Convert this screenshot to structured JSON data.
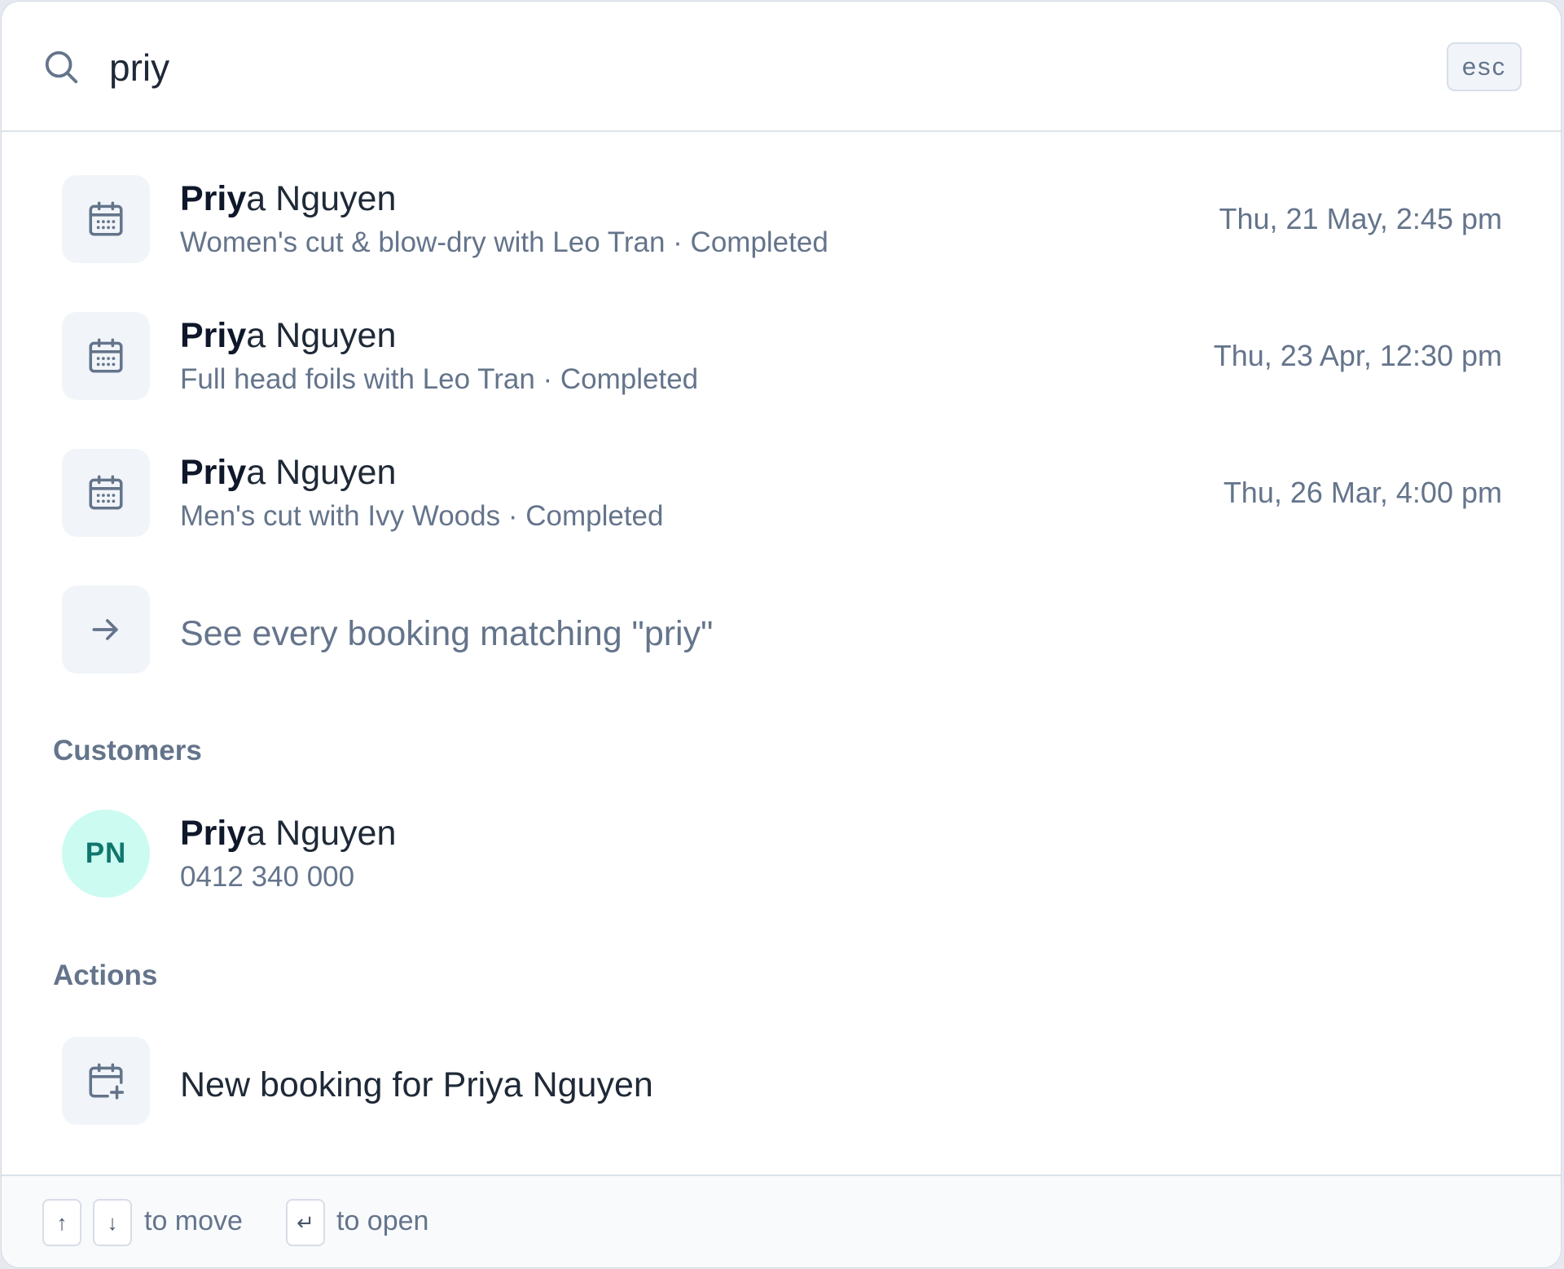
{
  "search": {
    "query": "priy",
    "esc_label": "esc"
  },
  "bookings": [
    {
      "name_match": "Priy",
      "name_rest": "a Nguyen",
      "detail": "Women's cut & blow-dry with Leo Tran · Completed",
      "datetime": "Thu, 21 May, 2:45 pm",
      "icon": "calendar-icon"
    },
    {
      "name_match": "Priy",
      "name_rest": "a Nguyen",
      "detail": "Full head foils with Leo Tran · Completed",
      "datetime": "Thu, 23 Apr, 12:30 pm",
      "icon": "calendar-icon"
    },
    {
      "name_match": "Priy",
      "name_rest": "a Nguyen",
      "detail": "Men's cut with Ivy Woods · Completed",
      "datetime": "Thu, 26 Mar, 4:00 pm",
      "icon": "calendar-icon"
    }
  ],
  "see_all": {
    "label": "See every booking matching \"priy\"",
    "icon": "arrow-right-icon"
  },
  "customers": {
    "heading": "Customers",
    "items": [
      {
        "initials": "PN",
        "name_match": "Priy",
        "name_rest": "a Nguyen",
        "phone": "0412 340 000"
      }
    ]
  },
  "actions": {
    "heading": "Actions",
    "items": [
      {
        "label": "New booking for Priya Nguyen",
        "icon": "calendar-plus-icon"
      }
    ]
  },
  "footer": {
    "up_key": "↑",
    "down_key": "↓",
    "move_label": "to move",
    "enter_key": "↵",
    "open_label": "to open"
  },
  "colors": {
    "avatar_bg": "#ccfbf1",
    "avatar_text": "#0f766e",
    "muted_text": "#64748b",
    "tile_bg": "#f1f5f9"
  }
}
